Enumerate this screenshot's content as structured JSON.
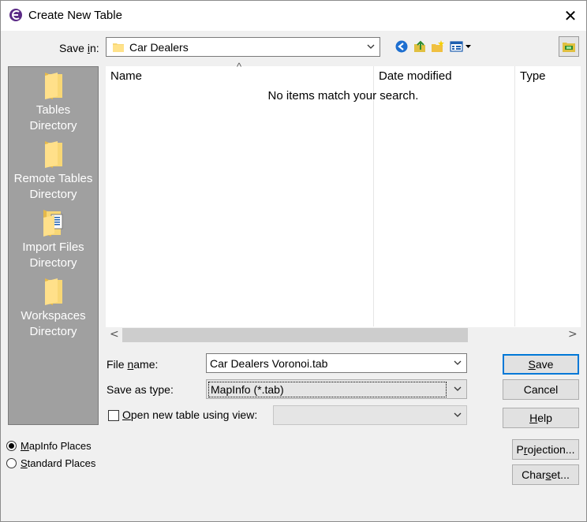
{
  "window": {
    "title": "Create New Table",
    "close_glyph": "✕"
  },
  "save_in": {
    "label_pre": "Save ",
    "label_u": "i",
    "label_post": "n:",
    "value": "Car Dealers"
  },
  "toolbar": {
    "icons": [
      "back-icon",
      "up-folder-icon",
      "new-folder-icon",
      "view-menu-icon",
      "network-folder-icon"
    ]
  },
  "places": {
    "items": [
      {
        "line1": "Tables",
        "line2": "Directory",
        "icon": "folder-icon"
      },
      {
        "line1": "Remote Tables",
        "line2": "Directory",
        "icon": "folder-icon"
      },
      {
        "line1": "Import Files",
        "line2": "Directory",
        "icon": "document-folder-icon"
      },
      {
        "line1": "Workspaces",
        "line2": "Directory",
        "icon": "folder-icon"
      }
    ]
  },
  "file_list": {
    "columns": [
      "Name",
      "Date modified",
      "Type"
    ],
    "empty_message": "No items match your search.",
    "sort_glyph": "^",
    "scroll_left": "<",
    "scroll_right": ">"
  },
  "form": {
    "file_name_label_pre": "File ",
    "file_name_label_u": "n",
    "file_name_label_post": "ame:",
    "file_name_value": "Car Dealers Voronoi.tab",
    "save_type_label": "Save as type:",
    "save_type_value": "MapInfo (*.tab)",
    "open_view_label_u": "O",
    "open_view_label_post": "pen new table using view:",
    "open_view_value": ""
  },
  "buttons": {
    "save_u": "S",
    "save_post": "ave",
    "cancel": "Cancel",
    "help_u": "H",
    "help_post": "elp",
    "projection_pre": "P",
    "projection_u": "r",
    "projection_post": "ojection...",
    "charset_pre": "Char",
    "charset_u": "s",
    "charset_post": "et..."
  },
  "radios": [
    {
      "u": "M",
      "post": "apInfo Places",
      "selected": true
    },
    {
      "u": "S",
      "post": "tandard Places",
      "selected": false
    }
  ],
  "colors": {
    "accent": "#0078d7",
    "places_bg": "#a0a0a0",
    "folder": "#f8d775"
  }
}
